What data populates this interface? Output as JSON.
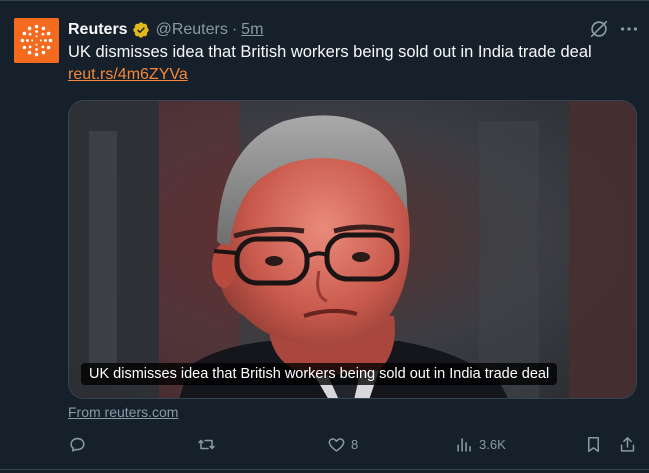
{
  "author": {
    "name": "Reuters",
    "handle": "@Reuters",
    "separator": "·",
    "time": "5m",
    "verified_icon": "gold-verified-badge",
    "avatar_icon": "reuters-logo"
  },
  "tweet": {
    "text": "UK dismisses idea that British workers being sold out in India trade deal",
    "link": "reut.rs/4m6ZYVa"
  },
  "media": {
    "caption": "UK dismisses idea that British workers being sold out in India trade deal",
    "source": "From reuters.com"
  },
  "actions": {
    "reply": {
      "icon": "reply-icon",
      "count": ""
    },
    "retweet": {
      "icon": "retweet-icon",
      "count": ""
    },
    "like": {
      "icon": "heart-icon",
      "count": "8"
    },
    "views": {
      "icon": "views-icon",
      "count": "3.6K"
    },
    "bookmark": {
      "icon": "bookmark-icon"
    },
    "share": {
      "icon": "share-icon"
    }
  },
  "colors": {
    "background": "#15202b",
    "link": "#f4883a",
    "muted": "#8b98a5",
    "verified": "#e2b719",
    "brand": "#f46a1f"
  }
}
